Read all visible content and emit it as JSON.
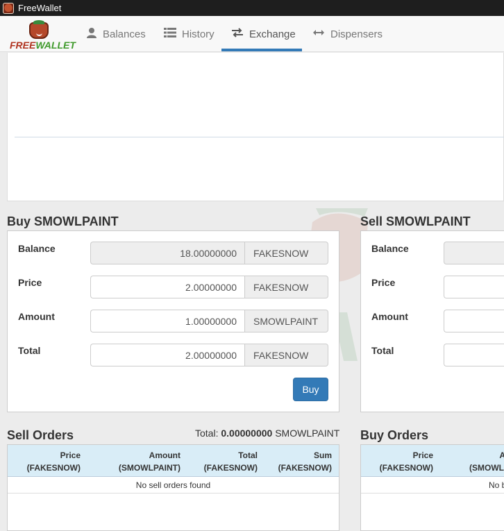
{
  "window": {
    "title": "FreeWallet"
  },
  "logo": {
    "free": "FREE",
    "wallet": "WALLET"
  },
  "nav": {
    "items": [
      {
        "label": "Balances",
        "icon": "user-icon"
      },
      {
        "label": "History",
        "icon": "list-icon"
      },
      {
        "label": "Exchange",
        "icon": "exchange-icon"
      },
      {
        "label": "Dispensers",
        "icon": "double-arrow-icon"
      }
    ],
    "active": "Exchange",
    "accent_color": "#337ab7"
  },
  "buy_form": {
    "title": "Buy SMOWLPAINT",
    "rows": [
      {
        "label": "Balance",
        "value": "18.00000000",
        "unit": "FAKESNOW",
        "readonly": true
      },
      {
        "label": "Price",
        "value": "2.00000000",
        "unit": "FAKESNOW",
        "readonly": false
      },
      {
        "label": "Amount",
        "value": "1.00000000",
        "unit": "SMOWLPAINT",
        "readonly": false
      },
      {
        "label": "Total",
        "value": "2.00000000",
        "unit": "FAKESNOW",
        "readonly": false
      }
    ],
    "button": "Buy"
  },
  "sell_form": {
    "title": "Sell SMOWLPAINT",
    "rows": [
      {
        "label": "Balance"
      },
      {
        "label": "Price"
      },
      {
        "label": "Amount"
      },
      {
        "label": "Total"
      }
    ]
  },
  "sell_orders": {
    "title": "Sell Orders",
    "total_prefix": "Total:",
    "total_value": "0.00000000",
    "total_unit": "SMOWLPAINT",
    "columns": [
      {
        "line1": "Price",
        "line2": "(FAKESNOW)"
      },
      {
        "line1": "Amount",
        "line2": "(SMOWLPAINT)"
      },
      {
        "line1": "Total",
        "line2": "(FAKESNOW)"
      },
      {
        "line1": "Sum",
        "line2": "(FAKESNOW)"
      }
    ],
    "empty_message": "No sell orders found"
  },
  "buy_orders": {
    "title": "Buy Orders",
    "columns": [
      {
        "line1": "Price",
        "line2": "(FAKESNOW)"
      },
      {
        "line1": "A",
        "line2": "(SMOWL"
      }
    ],
    "empty_message": "No b"
  }
}
